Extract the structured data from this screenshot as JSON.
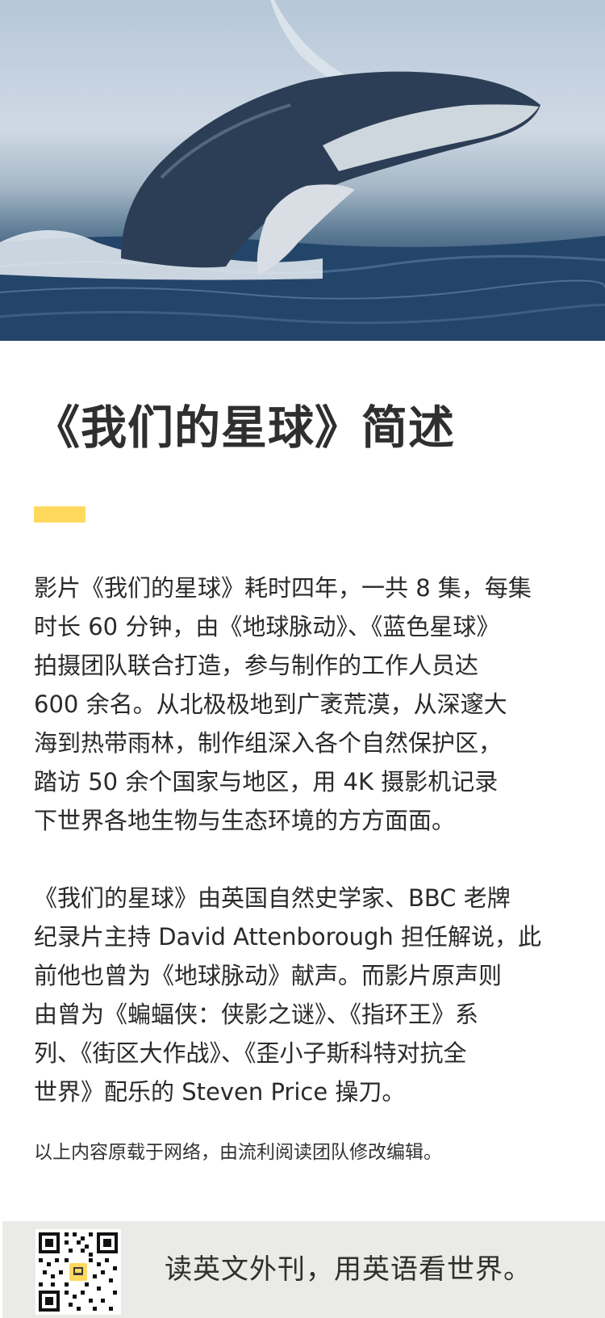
{
  "hero": {
    "image_label": "humpback-whale-breaching-photo"
  },
  "article": {
    "title": "《我们的星球》简述",
    "paragraphs": [
      [
        "影片《我们的星球》耗时四年，一共 8 集，每集",
        "时长 60 分钟，由《地球脉动》、《蓝色星球》",
        "拍摄团队联合打造，参与制作的工作人员达",
        "600 余名。从北极极地到广袤荒漠，从深邃大",
        "海到热带雨林，制作组深入各个自然保护区，",
        "踏访 50 余个国家与地区，用 4K 摄影机记录",
        "下世界各地生物与生态环境的方方面面。"
      ],
      [
        "《我们的星球》由英国自然史学家、BBC 老牌",
        "纪录片主持 David Attenborough 担任解说，此",
        "前他也曾为《地球脉动》献声。而影片原声则",
        "由曾为《蝙蝠侠：侠影之谜》、《指环王》系",
        "列、《街区大作战》、《歪小子斯科特对抗全",
        "世界》配乐的 Steven Price 操刀。"
      ]
    ],
    "source_note": "以上内容原载于网络，由流利阅读团队修改编辑。"
  },
  "footer": {
    "slogan": "读英文外刊，用英语看世界。",
    "qr_icon": "qr-code-icon"
  },
  "colors": {
    "accent": "#ffd95e",
    "footer_bg": "#eaeae6",
    "text": "#2a2a2a"
  }
}
